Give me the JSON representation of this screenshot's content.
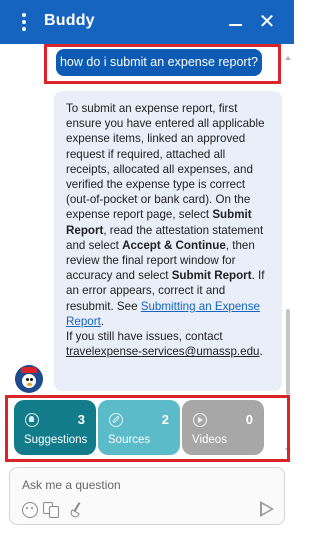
{
  "header": {
    "title": "Buddy",
    "menu_icon": "kebab-menu-icon",
    "minimize_icon": "minimize-icon",
    "close_icon": "close-icon",
    "close_glyph": "✕",
    "color": "#1565c0"
  },
  "conversation": {
    "user_message": "how do i submit an expense report?",
    "bot_message": {
      "p1_a": "To submit an expense report, first ensure you have entered all applicable expense items, linked an approved request if required, attached all receipts, allocated all expenses, and verified the expense type is correct (out-of-pocket or bank card). On the expense report page, select ",
      "p1_b": "Submit Report",
      "p1_c": ", read the attestation statement and select ",
      "p1_d": "Accept & Continue",
      "p1_e": ", then review the final report window for accuracy and select ",
      "p1_f": "Submit Report",
      "p1_g": ". If an error appears, correct it and resubmit. See ",
      "p1_link": "Submitting an Expense Report",
      "p1_h": ".",
      "p2_a": "If you still have issues, contact ",
      "p2_email": "travelexpense-services@umassp.edu",
      "p2_b": "."
    },
    "bot_avatar_icon": "penguin-avatar-icon"
  },
  "resources": [
    {
      "label": "Suggestions",
      "count": "3",
      "icon": "lightbulb-icon",
      "color": "#137c8b"
    },
    {
      "label": "Sources",
      "count": "2",
      "icon": "link-icon",
      "color": "#5bbbc9"
    },
    {
      "label": "Videos",
      "count": "0",
      "icon": "play-circle-icon",
      "color": "#a7a7a7"
    }
  ],
  "composer": {
    "placeholder": "Ask me a question",
    "tools": [
      "emoji-icon",
      "translate-icon",
      "clear-chat-icon"
    ],
    "send_icon": "send-icon"
  },
  "highlight_color": "#d9252a"
}
